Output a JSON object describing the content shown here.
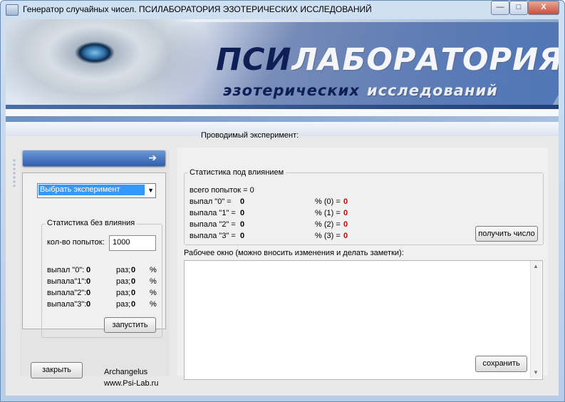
{
  "window": {
    "title": "Генератор случайных чисел. ПСИЛАБОРАТОРИЯ ЭЗОТЕРИЧЕСКИХ ИССЛЕДОВАНИЙ",
    "controls": {
      "minimize": "—",
      "maximize": "□",
      "close": "X"
    }
  },
  "banner": {
    "logo_part1": "ПСИ",
    "logo_part2": "ЛАБОРАТОРИЯ",
    "tagline_part1": "эзотерических",
    "tagline_part2": "исследований"
  },
  "experiment": {
    "label": "Проводимый эксперимент:"
  },
  "left": {
    "nav_arrow": "➔",
    "select_value": "Выбрать эксперимент",
    "stats_title": "Статистика без влияния",
    "attempts_label": "кол-во попыток:",
    "attempts_value": "1000",
    "rows": [
      {
        "label": "выпал  \"0\":",
        "count": "0",
        "unit": "раз;",
        "pct": "0",
        "sign": "%"
      },
      {
        "label": "выпала\"1\":",
        "count": "0",
        "unit": "раз;",
        "pct": "0",
        "sign": "%"
      },
      {
        "label": "выпала\"2\":",
        "count": "0",
        "unit": "раз;",
        "pct": "0",
        "sign": "%"
      },
      {
        "label": "выпала\"3\":",
        "count": "0",
        "unit": "раз;",
        "pct": "0",
        "sign": "%"
      }
    ],
    "start_button": "запустить",
    "close_button": "закрыть",
    "author": "Archangelus",
    "site": "www.Psi-Lab.ru"
  },
  "influence": {
    "title": "Статистика под влиянием",
    "total_label": "всего попыток = 0",
    "rows": [
      {
        "label": "выпал   \"0\" =",
        "count": "0",
        "pct_label": "% (0) =",
        "pct": "0"
      },
      {
        "label": "выпала \"1\" =",
        "count": "0",
        "pct_label": "% (1) =",
        "pct": "0"
      },
      {
        "label": "выпала \"2\" =",
        "count": "0",
        "pct_label": "% (2) =",
        "pct": "0"
      },
      {
        "label": "выпала \"3\" =",
        "count": "0",
        "pct_label": "% (3) =",
        "pct": "0"
      }
    ],
    "get_number_button": "получить число"
  },
  "work": {
    "label": "Рабочее окно (можно вносить изменения и делать заметки):",
    "content": "",
    "save_button": "сохранить"
  }
}
